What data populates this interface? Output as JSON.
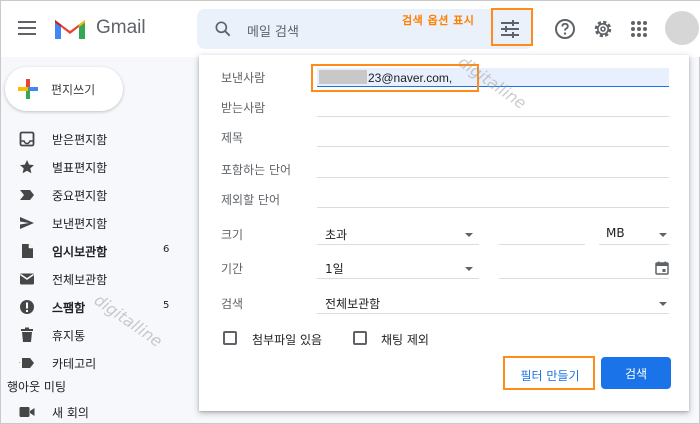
{
  "header": {
    "logo_text": "Gmail",
    "search_placeholder": "메일 검색",
    "options_label": "검색 옵션 표시"
  },
  "sidebar": {
    "compose_label": "편지쓰기",
    "items": [
      {
        "label": "받은편지함",
        "count": "",
        "icon": "inbox-icon",
        "bold": false
      },
      {
        "label": "별표편지함",
        "count": "",
        "icon": "star-icon",
        "bold": false
      },
      {
        "label": "중요편지함",
        "count": "",
        "icon": "important-icon",
        "bold": false
      },
      {
        "label": "보낸편지함",
        "count": "",
        "icon": "send-icon",
        "bold": false
      },
      {
        "label": "임시보관함",
        "count": "6",
        "icon": "draft-icon",
        "bold": true
      },
      {
        "label": "전체보관함",
        "count": "",
        "icon": "mail-icon",
        "bold": false
      },
      {
        "label": "스팸함",
        "count": "5",
        "icon": "spam-icon",
        "bold": true
      },
      {
        "label": "휴지통",
        "count": "",
        "icon": "trash-icon",
        "bold": false
      },
      {
        "label": "카테고리",
        "count": "",
        "icon": "label-icon",
        "bold": false
      }
    ],
    "section_title": "행아웃 미팅",
    "meet_item": "새 회의"
  },
  "panel": {
    "from_label": "보낸사람",
    "from_value": "23@naver.com,",
    "to_label": "받는사람",
    "subject_label": "제목",
    "has_words_label": "포함하는 단어",
    "doesnt_have_label": "제외할 단어",
    "size_label": "크기",
    "size_operator": "초과",
    "size_unit": "MB",
    "date_label": "기간",
    "date_within": "1일",
    "search_label": "검색",
    "search_scope": "전체보관함",
    "attachment_label": "첨부파일 있음",
    "exclude_chats_label": "채팅 제외",
    "filter_button": "필터 만들기",
    "search_button": "검색"
  },
  "watermark": "digitalline",
  "colors": {
    "accent": "#1a73e8",
    "highlight": "#ff8c1a"
  }
}
